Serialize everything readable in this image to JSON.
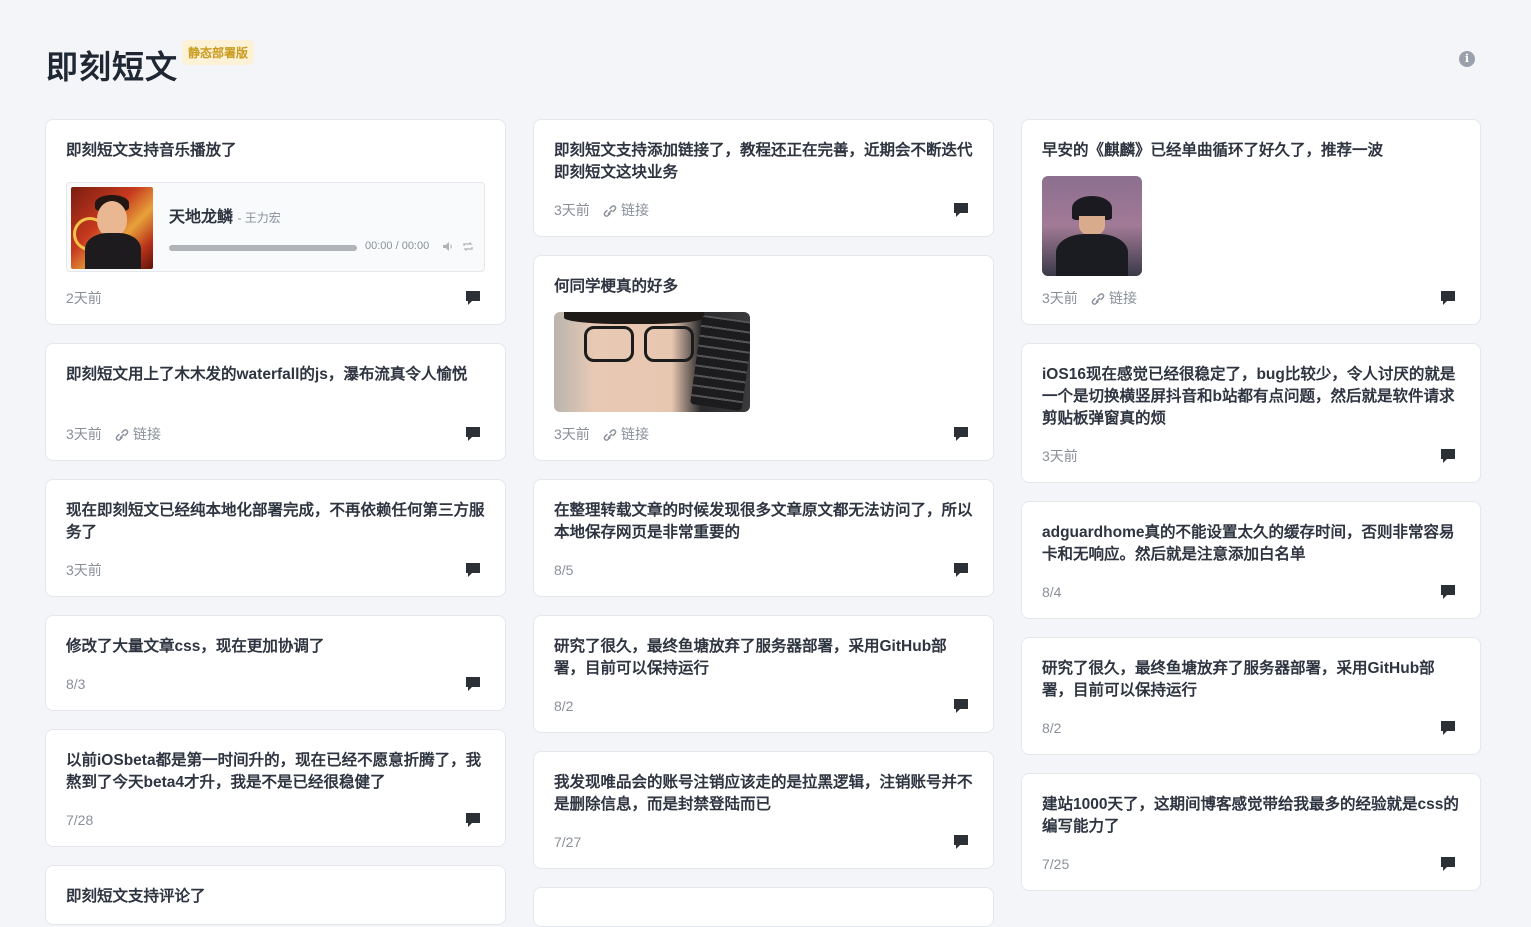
{
  "header": {
    "title": "即刻短文",
    "badge": "静态部署版"
  },
  "columns": [
    [
      {
        "text": "即刻短文支持音乐播放了",
        "date": "2天前",
        "link": "",
        "music": {
          "title": "天地龙鳞",
          "artist": "- 王力宏",
          "time": "00:00 / 00:00"
        }
      },
      {
        "text": "即刻短文用上了木木发的waterfall的js，瀑布流真令人愉悦",
        "date": "3天前",
        "link": "链接"
      },
      {
        "text": "现在即刻短文已经纯本地化部署完成，不再依赖任何第三方服务了",
        "date": "3天前",
        "link": ""
      },
      {
        "text": "修改了大量文章css，现在更加协调了",
        "date": "8/3",
        "link": ""
      },
      {
        "text": "以前iOSbeta都是第一时间升的，现在已经不愿意折腾了，我熬到了今天beta4才升，我是不是已经很稳健了",
        "date": "7/28",
        "link": ""
      },
      {
        "text": "即刻短文支持评论了",
        "date": "",
        "link": ""
      }
    ],
    [
      {
        "text": "即刻短文支持添加链接了，教程还正在完善，近期会不断迭代即刻短文这块业务",
        "date": "3天前",
        "link": "链接"
      },
      {
        "text": "何同学梗真的好多",
        "date": "3天前",
        "link": "链接",
        "image": "glasses"
      },
      {
        "text": "在整理转载文章的时候发现很多文章原文都无法访问了，所以本地保存网页是非常重要的",
        "date": "8/5",
        "link": ""
      },
      {
        "text": "研究了很久，最终鱼塘放弃了服务器部署，采用GitHub部署，目前可以保持运行",
        "date": "8/2",
        "link": ""
      },
      {
        "text": "我发现唯品会的账号注销应该走的是拉黑逻辑，注销账号并不是删除信息，而是封禁登陆而已",
        "date": "7/27",
        "link": ""
      },
      {
        "text": "",
        "date": "",
        "link": ""
      }
    ],
    [
      {
        "text": "早安的《麒麟》已经单曲循环了好久了，推荐一波",
        "date": "3天前",
        "link": "链接",
        "image": "jay"
      },
      {
        "text": "iOS16现在感觉已经很稳定了，bug比较少，令人讨厌的就是一个是切换横竖屏抖音和b站都有点问题，然后就是软件请求剪贴板弹窗真的烦",
        "date": "3天前",
        "link": ""
      },
      {
        "text": "adguardhome真的不能设置太久的缓存时间，否则非常容易卡和无响应。然后就是注意添加白名单",
        "date": "8/4",
        "link": ""
      },
      {
        "text": "研究了很久，最终鱼塘放弃了服务器部署，采用GitHub部署，目前可以保持运行",
        "date": "8/2",
        "link": ""
      },
      {
        "text": "建站1000天了，这期间博客感觉带给我最多的经验就是css的编写能力了",
        "date": "7/25",
        "link": ""
      }
    ]
  ],
  "icons": {
    "info": "info-icon",
    "comment": "comment-icon",
    "link": "link-icon"
  }
}
